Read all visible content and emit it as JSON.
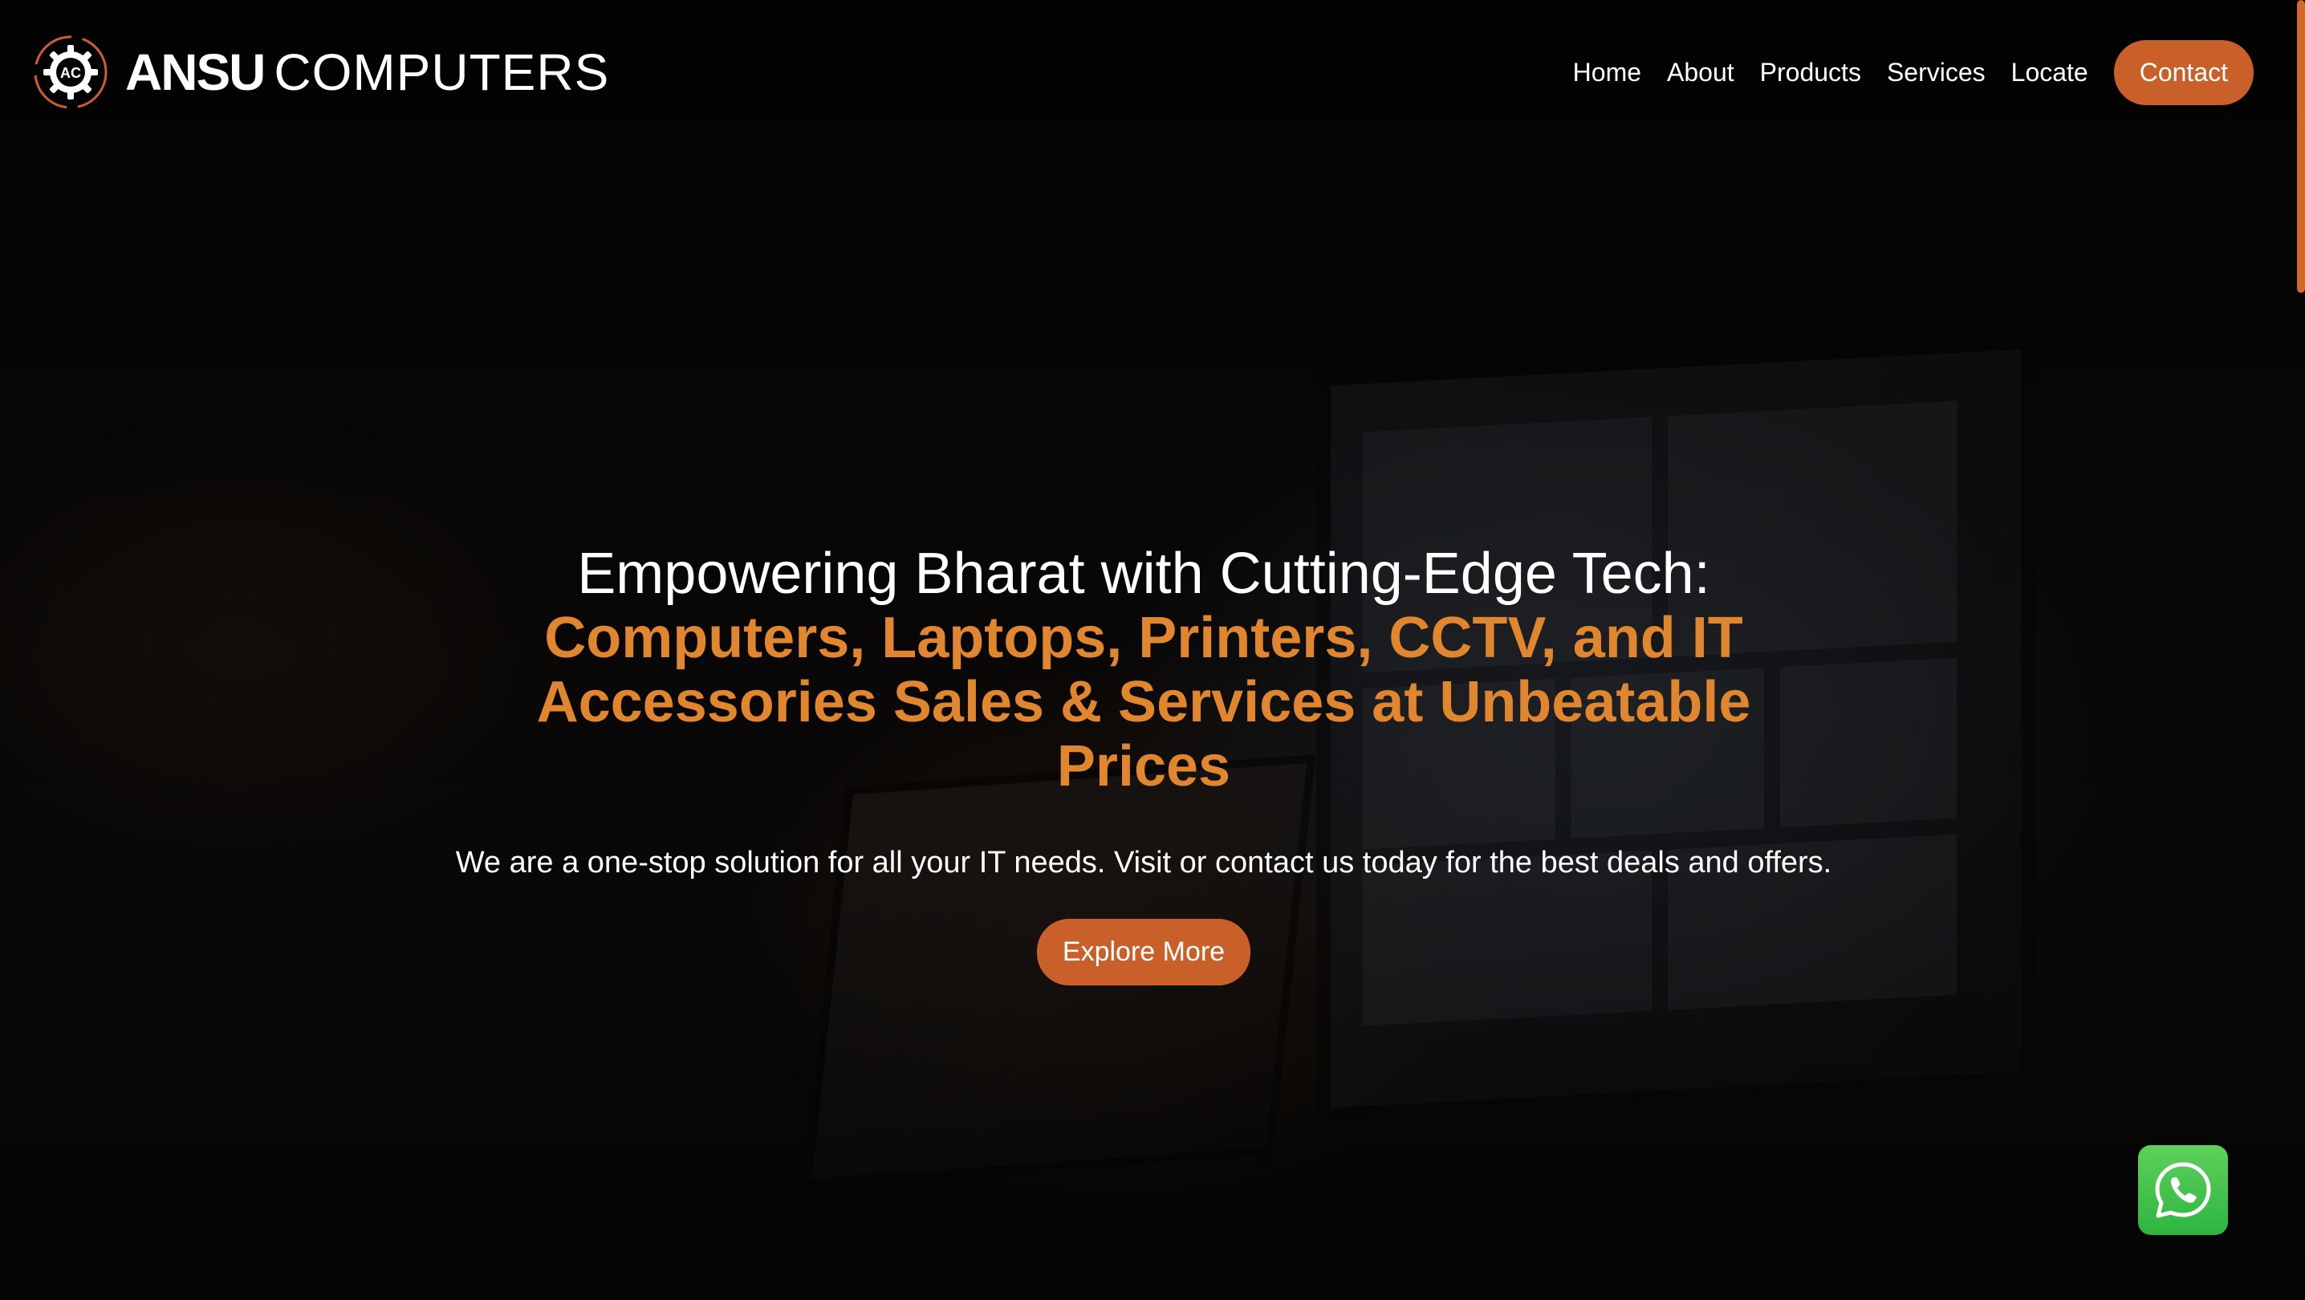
{
  "brand": {
    "name_bold": "ANSU",
    "name_light": "COMPUTERS",
    "logo_initials": "AC",
    "accent_color": "#c9602a",
    "highlight_color": "#e0862e"
  },
  "nav": {
    "items": [
      {
        "label": "Home"
      },
      {
        "label": "About"
      },
      {
        "label": "Products"
      },
      {
        "label": "Services"
      },
      {
        "label": "Locate"
      }
    ],
    "contact_label": "Contact"
  },
  "hero": {
    "heading_line1": "Empowering Bharat with Cutting-Edge Tech:",
    "heading_highlight": "Computers, Laptops, Printers, CCTV, and IT Accessories Sales & Services at Unbeatable Prices",
    "subtitle": "We are a one-stop solution for all your IT needs. Visit or contact us today for the best deals and offers.",
    "cta_label": "Explore More"
  },
  "floating": {
    "whatsapp_icon": "whatsapp-icon",
    "whatsapp_color": "#3cc14e"
  }
}
